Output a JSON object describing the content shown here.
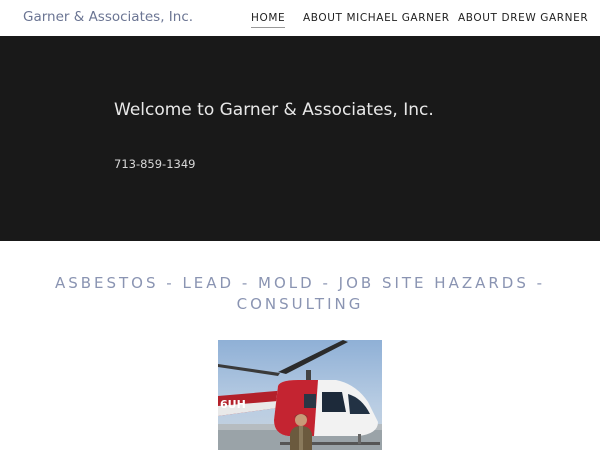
{
  "header": {
    "site_title": "Garner & Associates, Inc.",
    "nav": [
      {
        "label": "HOME",
        "active": true
      },
      {
        "label": "ABOUT MICHAEL GARNER",
        "active": false
      },
      {
        "label": "ABOUT DREW GARNER",
        "active": false
      }
    ]
  },
  "hero": {
    "title": "Welcome to Garner & Associates, Inc.",
    "phone": "713-859-1349",
    "background": "#191919"
  },
  "tagline": {
    "line1": "ASBESTOS - LEAD - MOLD - JOB SITE HAZARDS -",
    "line2": "CONSULTING",
    "color": "#8a94b2"
  },
  "photo": {
    "aircraft_marking": "6UH"
  }
}
